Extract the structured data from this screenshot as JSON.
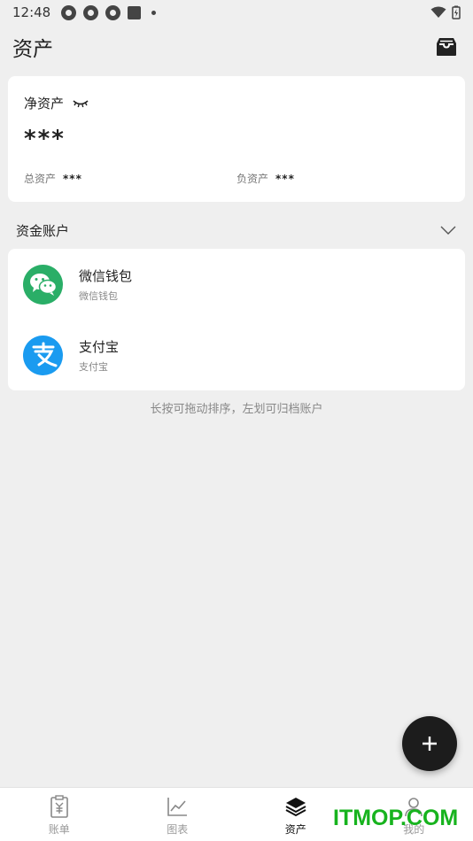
{
  "status_bar": {
    "time": "12:48"
  },
  "header": {
    "title": "资产",
    "action_icon": "archive-box-icon"
  },
  "net_assets": {
    "label": "净资产",
    "value": "***",
    "total_label": "总资产",
    "total_value": "***",
    "debt_label": "负资产",
    "debt_value": "***"
  },
  "section": {
    "title": "资金账户"
  },
  "accounts": [
    {
      "name": "微信钱包",
      "sub": "微信钱包",
      "icon": "wechat-icon",
      "color": "#2aae67"
    },
    {
      "name": "支付宝",
      "sub": "支付宝",
      "icon": "alipay-icon",
      "color": "#1a9bf0"
    }
  ],
  "hint": "长按可拖动排序，左划可归档账户",
  "nav": [
    {
      "label": "账单",
      "icon": "bill-icon"
    },
    {
      "label": "图表",
      "icon": "chart-icon"
    },
    {
      "label": "资产",
      "icon": "layers-icon"
    },
    {
      "label": "我的",
      "icon": "person-icon"
    }
  ],
  "watermark": "ITMOP.COM"
}
